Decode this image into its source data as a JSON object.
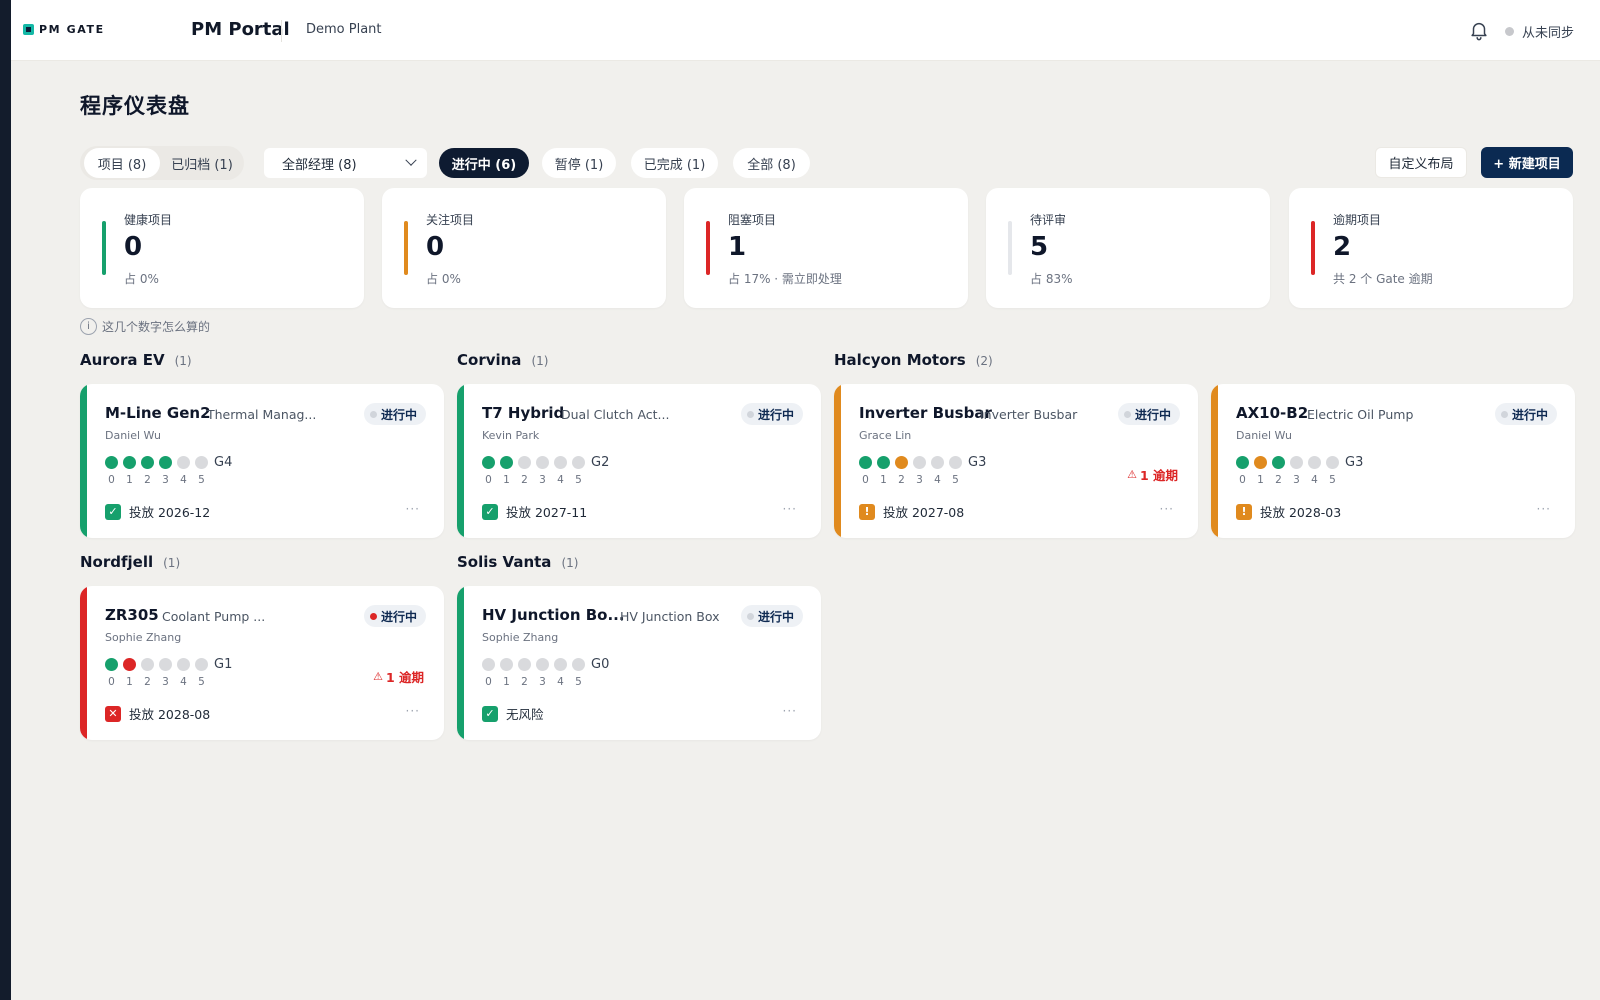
{
  "header": {
    "logo_text": "PM GATE",
    "app_title": "PM Portal",
    "plant": "Demo Plant",
    "sync_status": "从未同步"
  },
  "page": {
    "title": "程序仪表盘"
  },
  "toolbar": {
    "view_tabs": [
      {
        "label": "项目 (8)",
        "active": true
      },
      {
        "label": "已归档 (1)",
        "active": false
      }
    ],
    "manager_select": "全部经理 (8)",
    "status_filters": [
      {
        "label": "进行中 (6)",
        "active": true
      },
      {
        "label": "暂停 (1)",
        "active": false
      },
      {
        "label": "已完成 (1)",
        "active": false
      },
      {
        "label": "全部 (8)",
        "active": false
      }
    ],
    "custom_layout": "自定义布局",
    "new_project": "+ 新建项目"
  },
  "stats": [
    {
      "label": "健康项目",
      "value": "0",
      "sub": "占 0%",
      "color": "#16a06c"
    },
    {
      "label": "关注项目",
      "value": "0",
      "sub": "占 0%",
      "color": "#e08a1e"
    },
    {
      "label": "阻塞项目",
      "value": "1",
      "sub": "占 17% · 需立即处理",
      "color": "#dc2626"
    },
    {
      "label": "待评审",
      "value": "5",
      "sub": "占 83%",
      "color": "#e5e7eb"
    },
    {
      "label": "逾期项目",
      "value": "2",
      "sub": "共 2 个 Gate 逾期",
      "color": "#dc2626"
    }
  ],
  "help_text": "这几个数字怎么算的",
  "help_icon_glyph": "i",
  "groups": [
    {
      "name": "Aurora EV",
      "count": "(1)"
    },
    {
      "name": "Corvina",
      "count": "(1)"
    },
    {
      "name": "Halcyon Motors",
      "count": "(2)"
    },
    {
      "name": "Nordfjell",
      "count": "(1)"
    },
    {
      "name": "Solis Vanta",
      "count": "(1)"
    }
  ],
  "gate_numbers": [
    "0",
    "1",
    "2",
    "3",
    "4",
    "5"
  ],
  "colors": {
    "green": "#16a06c",
    "orange": "#e08a1e",
    "red": "#dc2626",
    "grey": "#d9dadd",
    "navy": "#0b2a52"
  },
  "projects": [
    {
      "name": "M-Line Gen2",
      "subtitle": "Thermal Manag...",
      "owner": "Daniel Wu",
      "status": "进行中",
      "status_dot": "grey",
      "accent": "green",
      "gates": [
        "green",
        "green",
        "green",
        "green",
        "grey",
        "grey"
      ],
      "current_gate": "G4",
      "overdue": "",
      "footer_icon": "check",
      "footer_text": "投放 2026-12"
    },
    {
      "name": "T7 Hybrid",
      "subtitle": "Dual Clutch Act...",
      "owner": "Kevin Park",
      "status": "进行中",
      "status_dot": "grey",
      "accent": "green",
      "gates": [
        "green",
        "green",
        "grey",
        "grey",
        "grey",
        "grey"
      ],
      "current_gate": "G2",
      "overdue": "",
      "footer_icon": "check",
      "footer_text": "投放 2027-11"
    },
    {
      "name": "Inverter Busbar",
      "subtitle": "Inverter Busbar",
      "owner": "Grace Lin",
      "status": "进行中",
      "status_dot": "grey",
      "accent": "orange",
      "gates": [
        "green",
        "green",
        "orange",
        "grey",
        "grey",
        "grey"
      ],
      "current_gate": "G3",
      "overdue": "1 逾期",
      "footer_icon": "warn",
      "footer_text": "投放 2027-08"
    },
    {
      "name": "AX10-B2",
      "subtitle": "Electric Oil Pump",
      "owner": "Daniel Wu",
      "status": "进行中",
      "status_dot": "grey",
      "accent": "orange",
      "gates": [
        "green",
        "orange",
        "green",
        "grey",
        "grey",
        "grey"
      ],
      "current_gate": "G3",
      "overdue": "",
      "footer_icon": "warn",
      "footer_text": "投放 2028-03"
    },
    {
      "name": "ZR305",
      "subtitle": "Coolant Pump ...",
      "owner": "Sophie Zhang",
      "status": "进行中",
      "status_dot": "red",
      "accent": "red",
      "gates": [
        "green",
        "red",
        "grey",
        "grey",
        "grey",
        "grey"
      ],
      "current_gate": "G1",
      "overdue": "1 逾期",
      "footer_icon": "cross",
      "footer_text": "投放 2028-08"
    },
    {
      "name": "HV Junction Bo...",
      "subtitle": "HV Junction Box",
      "owner": "Sophie Zhang",
      "status": "进行中",
      "status_dot": "grey",
      "accent": "green",
      "gates": [
        "grey",
        "grey",
        "grey",
        "grey",
        "grey",
        "grey"
      ],
      "current_gate": "G0",
      "overdue": "",
      "footer_icon": "check",
      "footer_text": "无风险"
    }
  ]
}
